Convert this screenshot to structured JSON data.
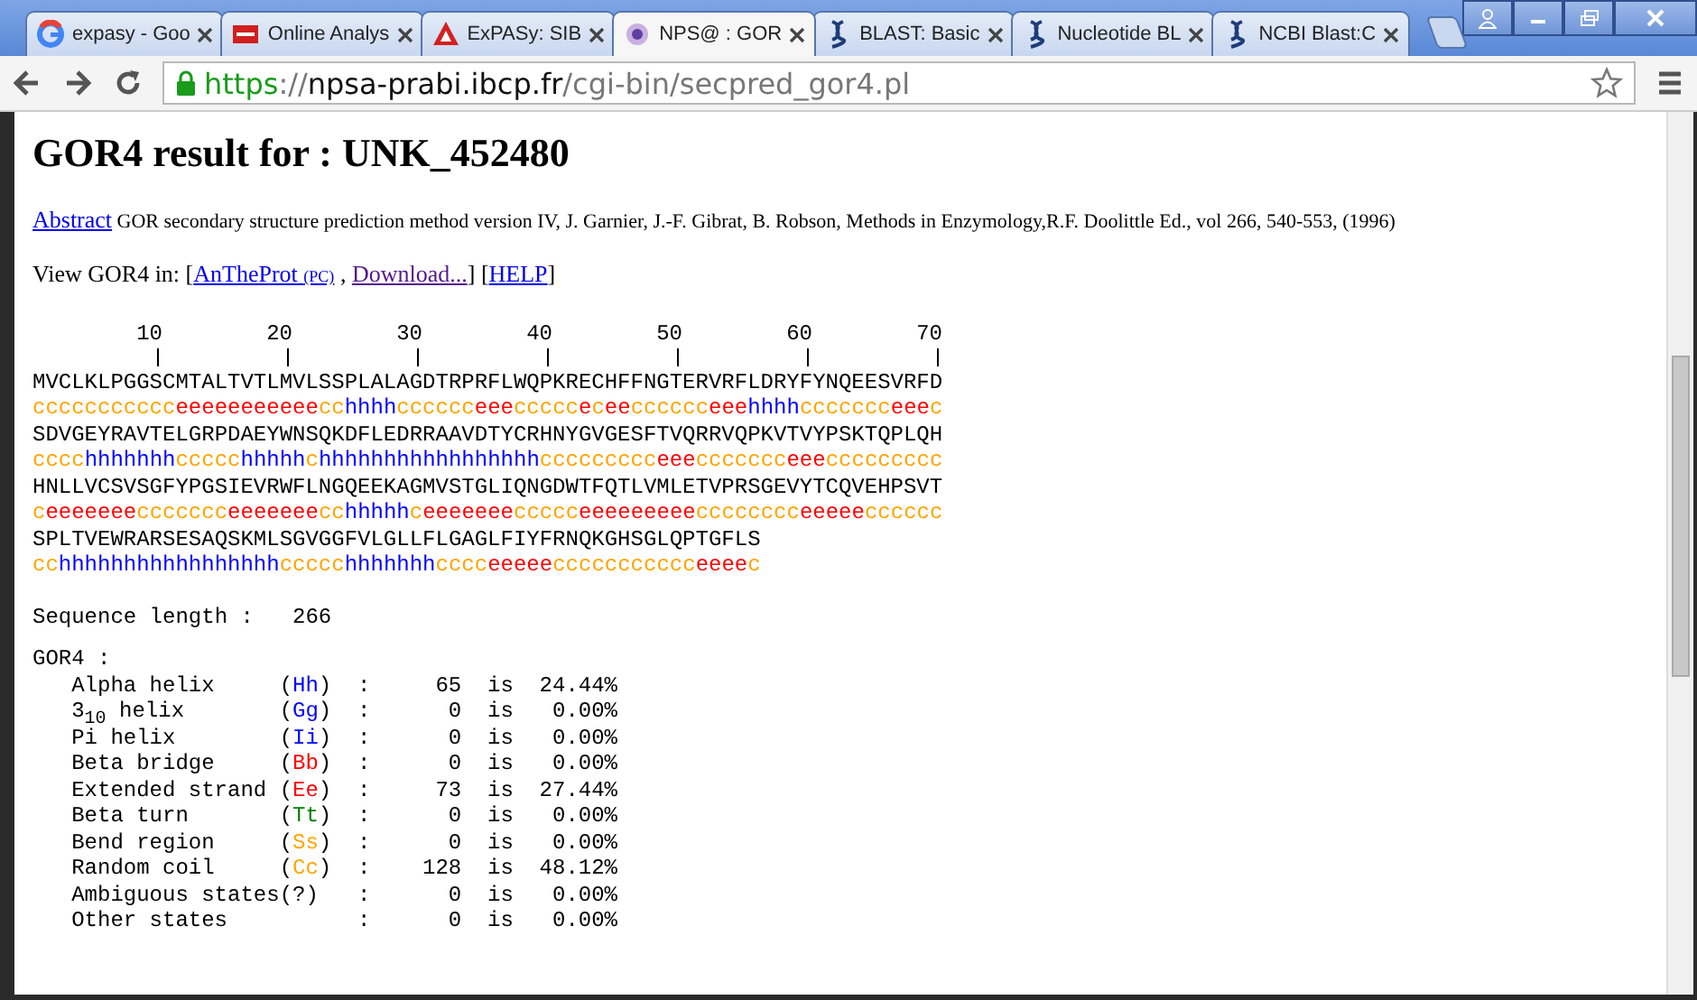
{
  "browser": {
    "tabs": [
      {
        "title": "expasy - Goo",
        "kind": "google",
        "selected": false
      },
      {
        "title": "Online Analys",
        "kind": "oat",
        "selected": false
      },
      {
        "title": "ExPASy: SIB",
        "kind": "expasy",
        "selected": false
      },
      {
        "title": "NPS@ : GOR",
        "kind": "nps",
        "selected": true
      },
      {
        "title": "BLAST: Basic",
        "kind": "helix",
        "selected": false
      },
      {
        "title": "Nucleotide BL",
        "kind": "helix",
        "selected": false
      },
      {
        "title": "NCBI Blast:C",
        "kind": "helix",
        "selected": false
      }
    ],
    "address": {
      "scheme": "https",
      "host": "://npsa-prabi.ibcp.fr",
      "path": "/cgi-bin/secpred_gor4.pl"
    }
  },
  "page": {
    "title": "GOR4 result for : UNK_452480",
    "abstract_link": "Abstract",
    "citation": "GOR secondary structure prediction method version IV, J. Garnier, J.-F. Gibrat, B. Robson, Methods in Enzymology,R.F. Doolittle Ed., vol 266, 540-553, (1996)",
    "view_label": "View GOR4 in: [",
    "links": [
      {
        "text": "AnTheProt",
        "small": "(PC)",
        "visited": false,
        "after": " , "
      },
      {
        "text": "Download...",
        "visited": true,
        "after": "] ["
      },
      {
        "text": "HELP",
        "visited": false,
        "after": "]"
      }
    ],
    "ruler": [
      "10",
      "20",
      "30",
      "40",
      "50",
      "60",
      "70"
    ],
    "blocks": [
      {
        "sequence": "MVCLKLPGGSCMTALTVTLMVLSSPLALAGDTRPRFLWQPKRECHFFNGTERVRFLDRYFYNQEESVRFD",
        "prediction": [
          {
            "kind": "coil",
            "text": "ccccccccccc"
          },
          {
            "kind": "strand",
            "text": "eeeeeeeeeee"
          },
          {
            "kind": "coil",
            "text": "cc"
          },
          {
            "kind": "helix",
            "text": "hhhh"
          },
          {
            "kind": "coil",
            "text": "cccccc"
          },
          {
            "kind": "strand",
            "text": "eee"
          },
          {
            "kind": "coil",
            "text": "ccccc"
          },
          {
            "kind": "strand",
            "text": "e"
          },
          {
            "kind": "coil",
            "text": "c"
          },
          {
            "kind": "strand",
            "text": "ee"
          },
          {
            "kind": "coil",
            "text": "cccccc"
          },
          {
            "kind": "strand",
            "text": "eee"
          },
          {
            "kind": "helix",
            "text": "hhhh"
          },
          {
            "kind": "coil",
            "text": "ccccccc"
          },
          {
            "kind": "strand",
            "text": "eee"
          },
          {
            "kind": "coil",
            "text": "c"
          }
        ]
      },
      {
        "sequence": "SDVGEYRAVTELGRPDAEYWNSQKDFLEDRRAAVDTYCRHNYGVGESFTVQRRVQPKVTVYPSKTQPLQH",
        "prediction": [
          {
            "kind": "coil",
            "text": "cccc"
          },
          {
            "kind": "helix",
            "text": "hhhhhhh"
          },
          {
            "kind": "coil",
            "text": "ccccc"
          },
          {
            "kind": "helix",
            "text": "hhhhh"
          },
          {
            "kind": "coil",
            "text": "c"
          },
          {
            "kind": "helix",
            "text": "hhhhhhhhhhhhhhhhh"
          },
          {
            "kind": "coil",
            "text": "ccccccccc"
          },
          {
            "kind": "strand",
            "text": "eee"
          },
          {
            "kind": "coil",
            "text": "ccccccc"
          },
          {
            "kind": "strand",
            "text": "eee"
          },
          {
            "kind": "coil",
            "text": "ccccccccc"
          }
        ]
      },
      {
        "sequence": "HNLLVCSVSGFYPGSIEVRWFLNGQEEKAGMVSTGLIQNGDWTFQTLVMLETVPRSGEVYTCQVEHPSVT",
        "prediction": [
          {
            "kind": "coil",
            "text": "c"
          },
          {
            "kind": "strand",
            "text": "eeeeeee"
          },
          {
            "kind": "coil",
            "text": "ccccccc"
          },
          {
            "kind": "strand",
            "text": "eeeeeee"
          },
          {
            "kind": "coil",
            "text": "cc"
          },
          {
            "kind": "helix",
            "text": "hhhhh"
          },
          {
            "kind": "coil",
            "text": "c"
          },
          {
            "kind": "strand",
            "text": "eeeeeee"
          },
          {
            "kind": "coil",
            "text": "ccccc"
          },
          {
            "kind": "strand",
            "text": "eeeeeeeee"
          },
          {
            "kind": "coil",
            "text": "cccccccc"
          },
          {
            "kind": "strand",
            "text": "eeeee"
          },
          {
            "kind": "coil",
            "text": "cccccc"
          }
        ]
      },
      {
        "sequence": "SPLTVEWRARSESAQSKMLSGVGGFVLGLLFLGAGLFIYFRNQKGHSGLQPTGFLS",
        "prediction": [
          {
            "kind": "coil",
            "text": "cc"
          },
          {
            "kind": "helix",
            "text": "hhhhhhhhhhhhhhhhh"
          },
          {
            "kind": "coil",
            "text": "ccccc"
          },
          {
            "kind": "helix",
            "text": "hhhhhhh"
          },
          {
            "kind": "coil",
            "text": "cccc"
          },
          {
            "kind": "strand",
            "text": "eeeee"
          },
          {
            "kind": "coil",
            "text": "ccccccccccc"
          },
          {
            "kind": "strand",
            "text": "eeee"
          },
          {
            "kind": "coil",
            "text": "c"
          }
        ]
      }
    ],
    "length_label": "Sequence length :",
    "length": "266",
    "stats_title": "GOR4 :",
    "stats": [
      {
        "label": "Alpha helix",
        "open": "(",
        "code": "Hh",
        "close": ")",
        "colon": ":",
        "color": "#0000ff",
        "count": "65",
        "is": "is",
        "percent": "24.44%"
      },
      {
        "label": "3$_{10}$ helix",
        "open": "(",
        "code": "Gg",
        "close": ")",
        "colon": ":",
        "color": "#0000ff",
        "count": "0",
        "is": "is",
        "percent": "0.00%"
      },
      {
        "label": "Pi helix",
        "open": "(",
        "code": "Ii",
        "close": ")",
        "colon": ":",
        "color": "#0000ff",
        "count": "0",
        "is": "is",
        "percent": "0.00%"
      },
      {
        "label": "Beta bridge",
        "open": "(",
        "code": "Bb",
        "close": ")",
        "colon": ":",
        "color": "#ff0000",
        "count": "0",
        "is": "is",
        "percent": "0.00%"
      },
      {
        "label": "Extended strand",
        "open": "(",
        "code": "Ee",
        "close": ")",
        "colon": ":",
        "color": "#ff0000",
        "count": "73",
        "is": "is",
        "percent": "27.44%"
      },
      {
        "label": "Beta turn",
        "open": "(",
        "code": "Tt",
        "close": ")",
        "colon": ":",
        "color": "#008000",
        "count": "0",
        "is": "is",
        "percent": "0.00%"
      },
      {
        "label": "Bend region",
        "open": "(",
        "code": "Ss",
        "close": ")",
        "colon": ":",
        "color": "#ffa500",
        "count": "0",
        "is": "is",
        "percent": "0.00%"
      },
      {
        "label": "Random coil",
        "open": "(",
        "code": "Cc",
        "close": ")",
        "colon": ":",
        "color": "#ffa500",
        "count": "128",
        "is": "is",
        "percent": "48.12%"
      },
      {
        "label": "Ambiguous states",
        "open": "(",
        "code": "?",
        "close": ")",
        "colon": ":",
        "color": "#000000",
        "count": "0",
        "is": "is",
        "percent": "0.00%"
      },
      {
        "label": "Other states",
        "colon": ":",
        "count": "0",
        "is": "is",
        "percent": "0.00%"
      }
    ]
  }
}
